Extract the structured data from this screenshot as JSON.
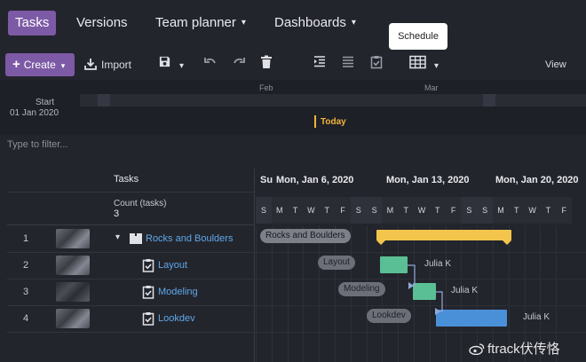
{
  "nav": {
    "tasks": "Tasks",
    "versions": "Versions",
    "team_planner": "Team planner",
    "dashboards": "Dashboards",
    "caret": "▾"
  },
  "tooltip": "Schedule",
  "toolbar": {
    "create_label": "Create",
    "import_label": "Import",
    "view_label": "View"
  },
  "timeline": {
    "start_label": "Start",
    "start_date": "01 Jan 2020",
    "months": [
      "Feb",
      "Mar"
    ],
    "today": "Today"
  },
  "filter": {
    "placeholder": "Type to filter..."
  },
  "table": {
    "header": "Tasks",
    "count_label": "Count (tasks)",
    "count_value": "3",
    "rows": [
      {
        "num": "1",
        "name": "Rocks and Boulders",
        "assignee": ""
      },
      {
        "num": "2",
        "name": "Layout",
        "assignee": "Julia K"
      },
      {
        "num": "3",
        "name": "Modeling",
        "assignee": "Julia K"
      },
      {
        "num": "4",
        "name": "Lookdev",
        "assignee": "Julia K"
      }
    ]
  },
  "gantt": {
    "week_labels": [
      "Su",
      "Mon, Jan 6, 2020",
      "Mon, Jan 13, 2020",
      "Mon, Jan 20, 2020"
    ],
    "days": [
      "S",
      "M",
      "T",
      "W",
      "T",
      "F",
      "S",
      "S",
      "M",
      "T",
      "W",
      "T",
      "F",
      "S",
      "S",
      "M",
      "T",
      "W",
      "T",
      "F"
    ]
  },
  "colors": {
    "accent": "#7d5aa6",
    "summary_bar": "#f4c54d",
    "task_green": "#5bbf95",
    "task_blue": "#4a90d9",
    "link_blue": "#5fa8e8",
    "today": "#f1b53a"
  },
  "watermark": "ftrack伏传恪"
}
